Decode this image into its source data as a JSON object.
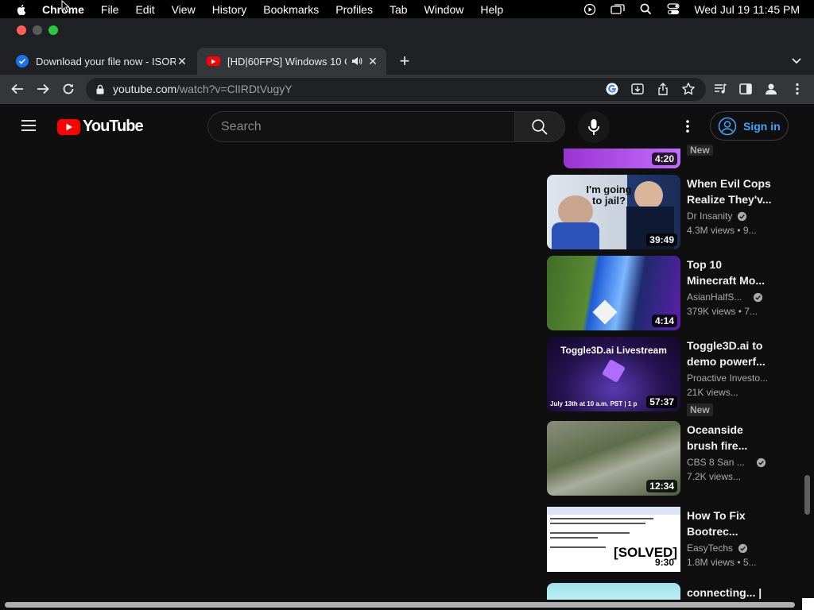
{
  "menubar": {
    "app": "Chrome",
    "items": [
      "File",
      "Edit",
      "View",
      "History",
      "Bookmarks",
      "Profiles",
      "Tab",
      "Window",
      "Help"
    ],
    "clock": "Wed Jul 19  11:45 PM"
  },
  "tabs": [
    {
      "title": "Download your file now - ISORI",
      "favicon_color": "#1a73e8"
    },
    {
      "title": "[HD|60FPS] Windows 10 C",
      "favicon_color": "#ff0000"
    }
  ],
  "address": {
    "host": "youtube.com",
    "path": "/watch?v=ClIRDtVugyY"
  },
  "youtube": {
    "logo_text": "YouTube",
    "search_placeholder": "Search",
    "signin_label": "Sign in"
  },
  "recommendations": [
    {
      "duration": "4:20",
      "line1": "",
      "line2": "",
      "channel": "",
      "meta": "",
      "badge": "New",
      "thumb_colors": [
        "#a23bd6",
        "#c06bff"
      ]
    },
    {
      "duration": "39:49",
      "line1": "When Evil Cops",
      "line2": "Realize They'v...",
      "channel": "Dr Insanity",
      "verified": true,
      "meta": "4.3M views  •  9...",
      "thumb_text": "I'm going to jail?",
      "thumb_colors": [
        "#e8ecf2",
        "#2a4f9e"
      ]
    },
    {
      "duration": "4:14",
      "line1": "Top 10",
      "line2": "Minecraft Mo...",
      "channel": "AsianHalfS...",
      "verified": true,
      "meta": "379K views  •  7...",
      "thumb_colors": [
        "#3d6b2a",
        "#1e5bd6",
        "#5b1fa8"
      ]
    },
    {
      "duration": "57:37",
      "line1": "Toggle3D.ai to",
      "line2": "demo powerf...",
      "channel": "Proactive Investo...",
      "meta": "21K views...",
      "badge": "New",
      "thumb_text": "Toggle3D.ai Livestream",
      "thumb_sub": "July 13th at 10 a.m. PST | 1 p",
      "thumb_colors": [
        "#1a0f3a",
        "#4b2a8f"
      ]
    },
    {
      "duration": "12:34",
      "line1": "Oceanside",
      "line2": "brush fire...",
      "channel": "CBS 8 San ...",
      "verified": true,
      "meta": "7.2K views...",
      "thumb_colors": [
        "#6a7a5a",
        "#9aa38a"
      ]
    },
    {
      "duration": "9:30",
      "line1": "How To Fix",
      "line2": "Bootrec...",
      "channel": "EasyTechs",
      "verified": true,
      "meta": "1.8M views  •  5...",
      "thumb_text": "[SOLVED]",
      "thumb_colors": [
        "#ffffff",
        "#e6e6e6"
      ]
    },
    {
      "duration": "",
      "line1": "connecting... |",
      "line2": "",
      "channel": "",
      "meta": "",
      "thumb_colors": [
        "#9fe0ec",
        "#bdeff5"
      ]
    }
  ],
  "colors": {
    "accent_blue": "#3ea6ff",
    "youtube_red": "#ff0000"
  }
}
